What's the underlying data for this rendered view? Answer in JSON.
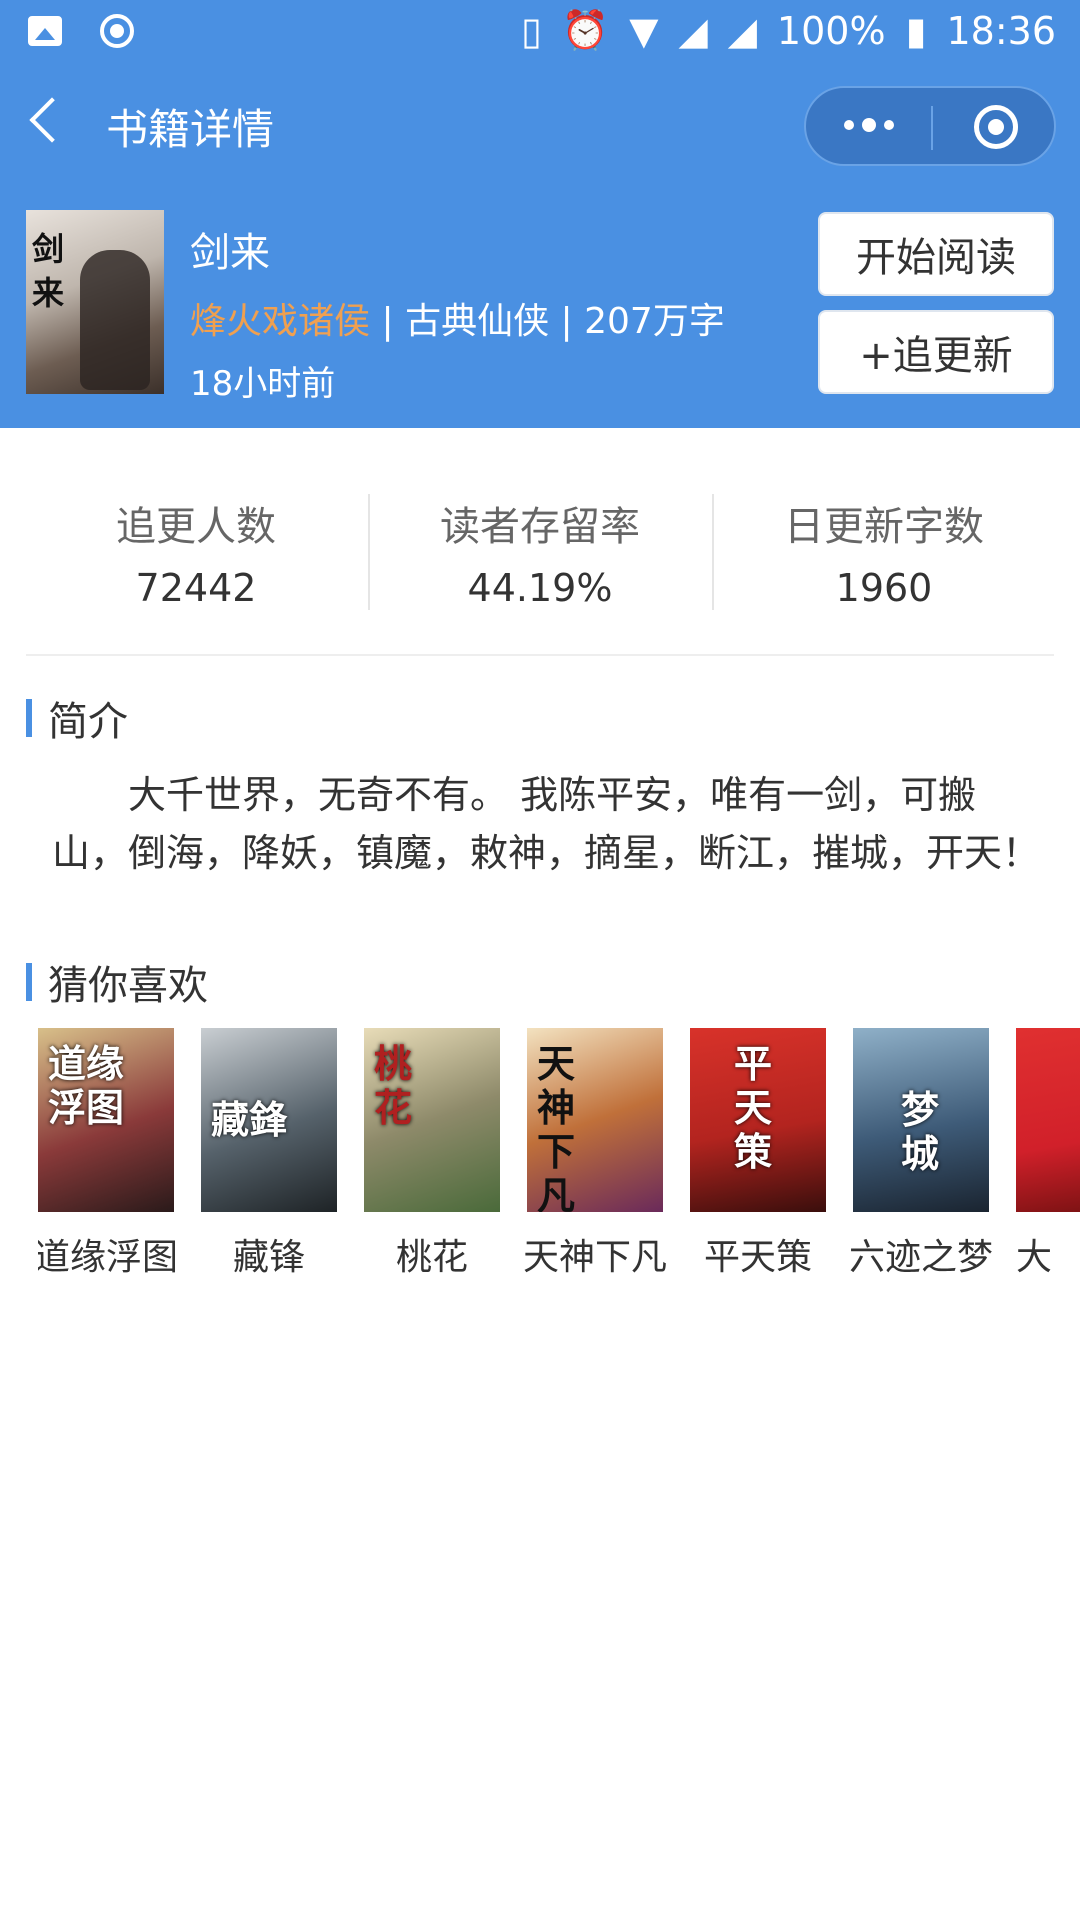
{
  "status_bar": {
    "battery": "100%",
    "time": "18:36"
  },
  "nav": {
    "title": "书籍详情"
  },
  "book": {
    "cover_title_chars": "剑来",
    "title": "剑来",
    "author": "烽火戏诸侯",
    "separator": "|",
    "genre": "古典仙侠",
    "word_count": "207万字",
    "updated": "18小时前"
  },
  "actions": {
    "start_reading": "开始阅读",
    "follow_updates": "+追更新"
  },
  "stats": [
    {
      "label": "追更人数",
      "value": "72442"
    },
    {
      "label": "读者存留率",
      "value": "44.19%"
    },
    {
      "label": "日更新字数",
      "value": "1960"
    }
  ],
  "intro": {
    "heading": "简介",
    "text": "大千世界，无奇不有。 我陈平安，唯有一剑，可搬山，倒海，降妖，镇魔，敕神，摘星，断江，摧城，开天！"
  },
  "recommend": {
    "heading": "猜你喜欢",
    "items": [
      {
        "name": "道缘浮图",
        "cover_text": "道缘浮图",
        "color": "#8a3a3a"
      },
      {
        "name": "藏锋",
        "cover_text": "藏鋒",
        "color": "#56626b"
      },
      {
        "name": "桃花",
        "cover_text": "桃花",
        "color": "#8e8a6a"
      },
      {
        "name": "天神下凡",
        "cover_text": "天神下凡",
        "color": "#c0703a"
      },
      {
        "name": "平天策",
        "cover_text": "平天策",
        "color": "#b3241f"
      },
      {
        "name": "六迹之梦",
        "cover_text": "梦城",
        "color": "#3e5b78"
      },
      {
        "name": "大",
        "cover_text": "",
        "color": "#d1202a"
      }
    ]
  }
}
